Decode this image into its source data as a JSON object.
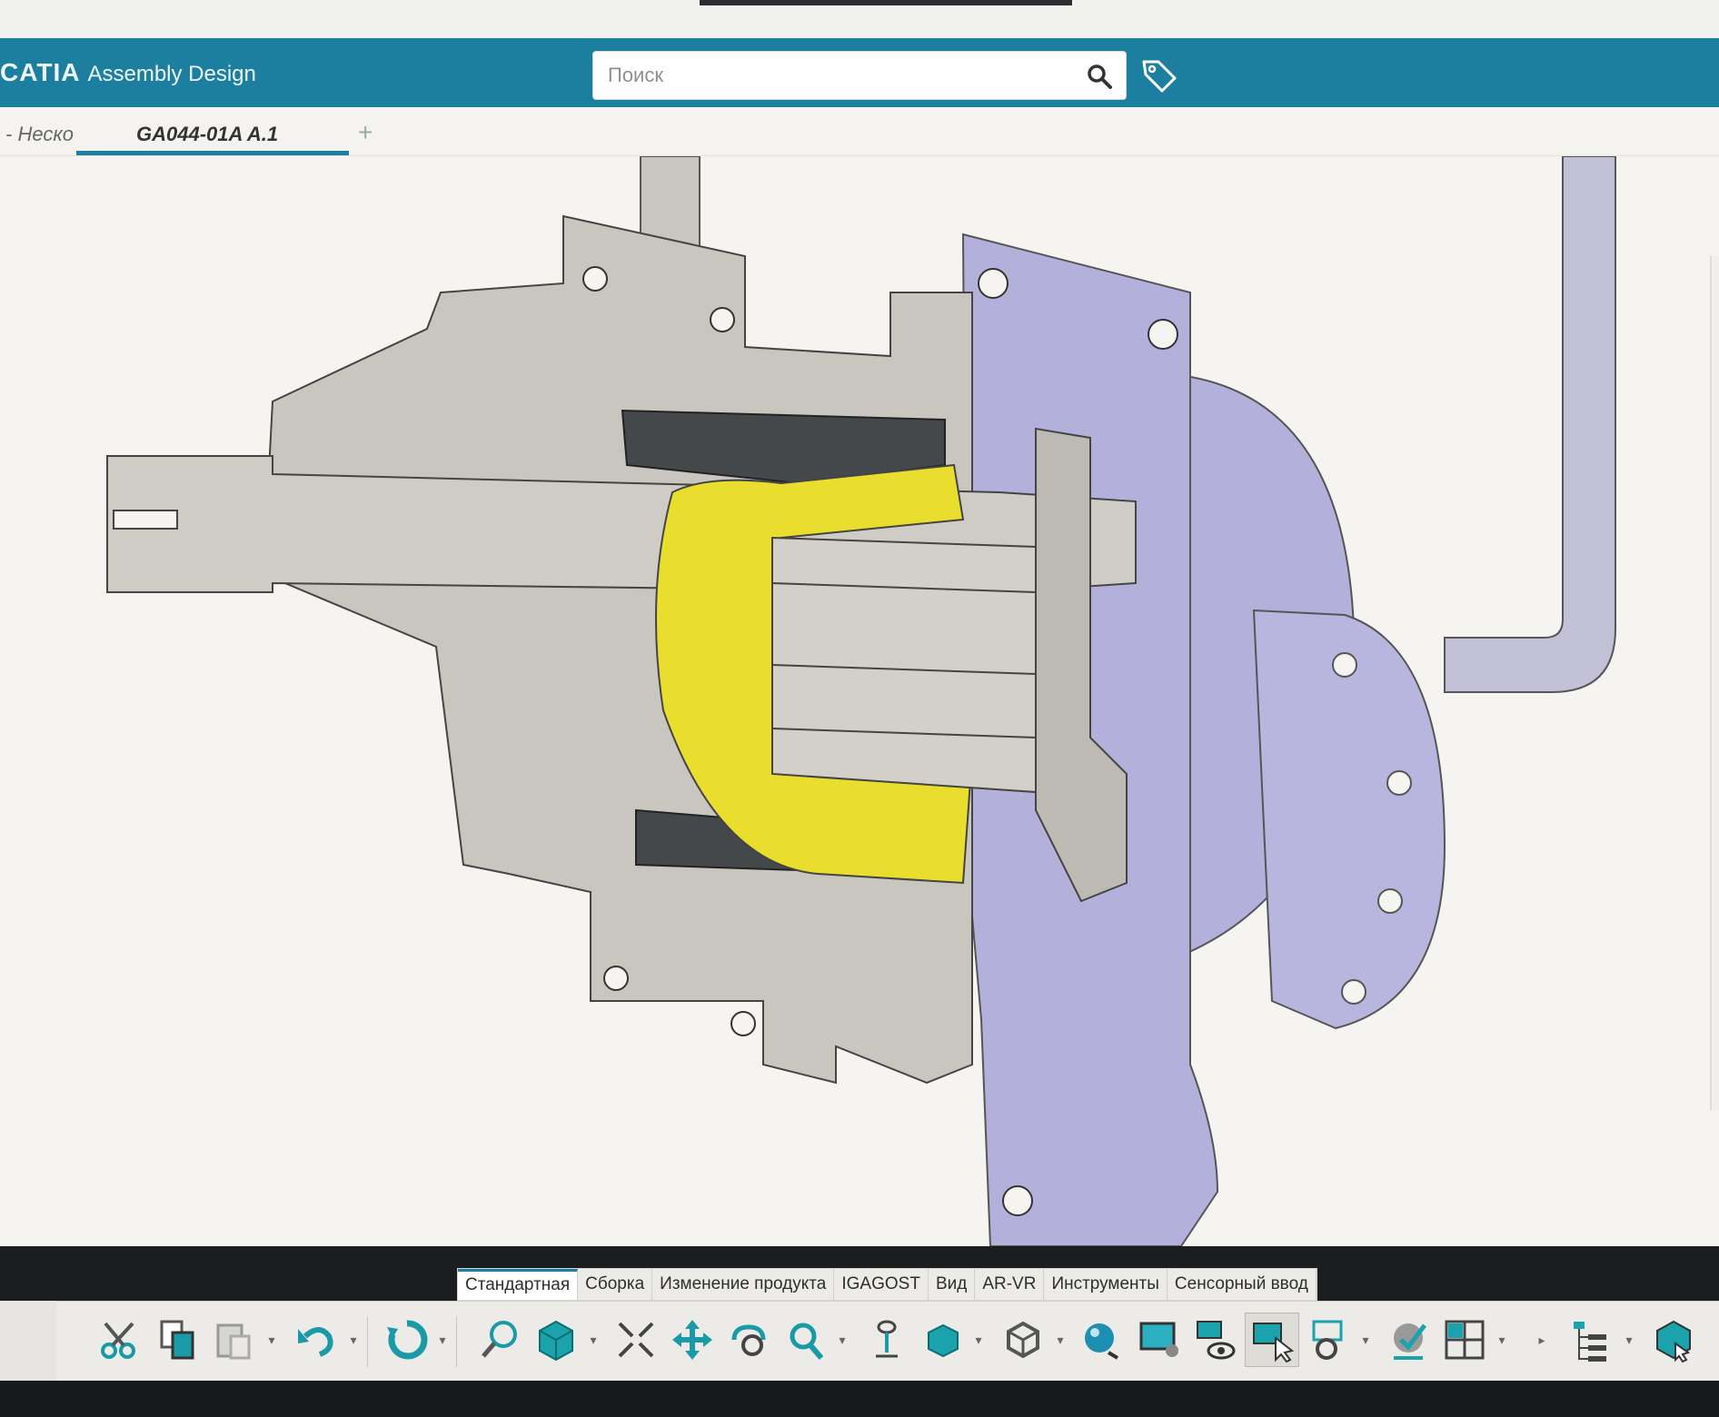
{
  "app": {
    "brand": "CATIA",
    "workbench": "Assembly Design"
  },
  "search": {
    "placeholder": "Поиск",
    "search_icon": "search-icon",
    "tag_icon": "tag-icon"
  },
  "tabs": {
    "previous_label": "- Неско",
    "active_label": "GA044-01A A.1",
    "add_label": "+"
  },
  "command_tabs": [
    "Стандартная",
    "Сборка",
    "Изменение продукта",
    "IGAGOST",
    "Вид",
    "AR-VR",
    "Инструменты",
    "Сенсорный ввод"
  ],
  "toolbar_icons": [
    "cut-icon",
    "copy-icon",
    "paste-icon",
    "undo-icon",
    "update-icon",
    "zoom-area-icon",
    "view-cube-icon",
    "fit-all-icon",
    "pan-icon",
    "rotate-icon",
    "zoom-icon",
    "normal-view-icon",
    "iso-view-icon",
    "render-style-icon",
    "material-sphere-icon",
    "capture-icon",
    "hide-show-icon",
    "select-icon",
    "swap-visible-icon",
    "apply-material-icon",
    "multi-view-icon",
    "tree-icon",
    "compass-icon"
  ],
  "colors": {
    "header": "#1d7fa0",
    "viewport": "#f5f4f1",
    "steel": "#c9c6bf",
    "casing_purple": "#b3b1dc",
    "bearing_yellow": "#e9de2e",
    "dark_part": "#45484b"
  }
}
